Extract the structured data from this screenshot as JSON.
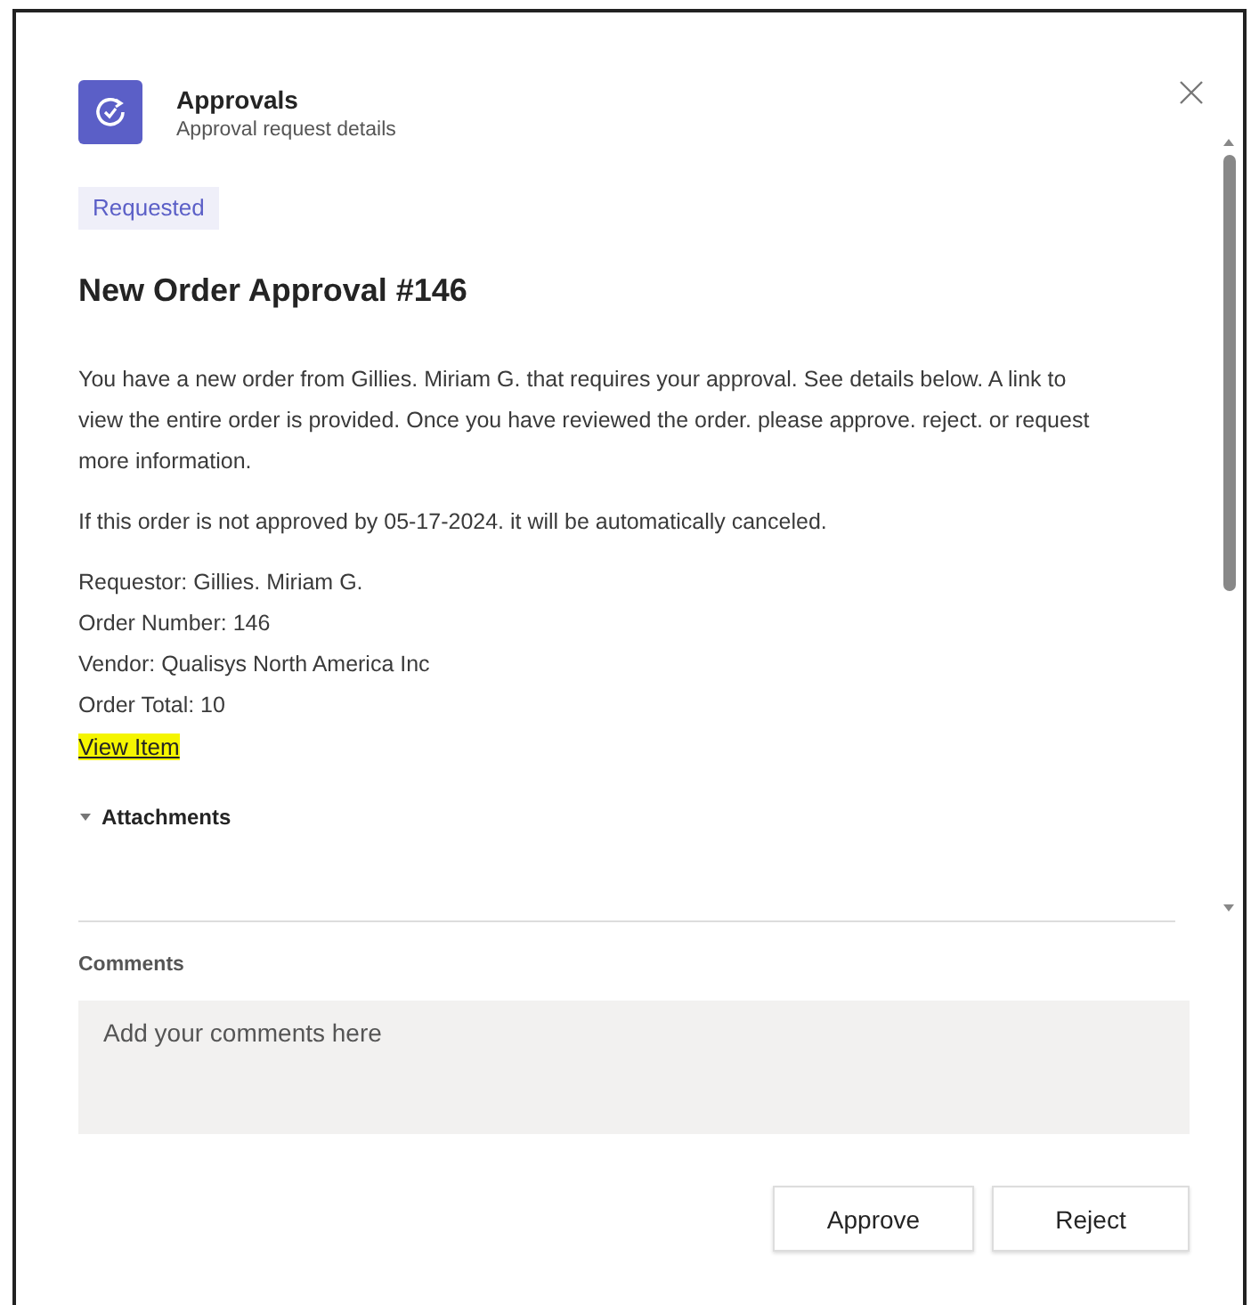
{
  "header": {
    "title": "Approvals",
    "subtitle": "Approval request details"
  },
  "status_badge": "Requested",
  "title": "New Order Approval #146",
  "paragraphs": [
    "You have a new order from Gillies. Miriam G. that requires your approval. See details below. A link to view the entire order is provided. Once you have reviewed the order. please approve. reject. or request more information.",
    "If this order is not approved by 05-17-2024. it will be automatically canceled."
  ],
  "details": [
    "Requestor: Gillies. Miriam G.",
    "Order Number: 146",
    "Vendor: Qualisys North America Inc",
    "Order Total: 10"
  ],
  "link": {
    "label": "View Item",
    "highlighted": true
  },
  "attachments": {
    "label": "Attachments",
    "expanded": true
  },
  "comments": {
    "label": "Comments",
    "placeholder": "Add your comments here"
  },
  "buttons": [
    "Approve",
    "Reject"
  ]
}
